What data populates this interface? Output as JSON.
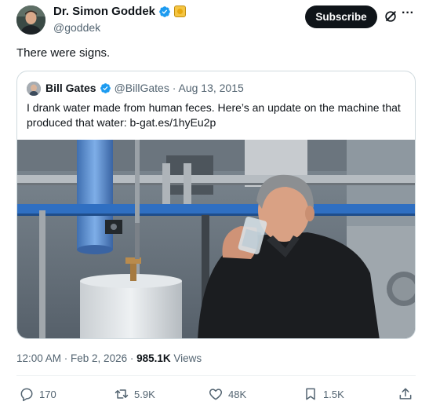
{
  "author": {
    "name": "Dr. Simon Goddek",
    "handle": "@goddek"
  },
  "header": {
    "subscribe_label": "Subscribe",
    "icons": [
      "verified-badge-icon",
      "affiliate-badge-icon",
      "grok-icon",
      "more-icon"
    ]
  },
  "tweet": {
    "text": "There were signs."
  },
  "quote": {
    "name": "Bill Gates",
    "handle_date": "@BillGates · Aug 13, 2015",
    "text": "I drank water made from human feces. Here’s an update on the machine that produced that water: b-gat.es/1hyEu2p"
  },
  "meta": {
    "timestamp": "12:00 AM · Feb 2, 2026 · ",
    "views_count": "985.1K",
    "views_label": " Views"
  },
  "actions": {
    "replies": "170",
    "reposts": "5.9K",
    "likes": "48K",
    "bookmarks": "1.5K"
  },
  "colors": {
    "verified": "#1d9bf0",
    "text": "#0f1419",
    "muted": "#536471",
    "subscribe_bg": "#0f1419"
  }
}
